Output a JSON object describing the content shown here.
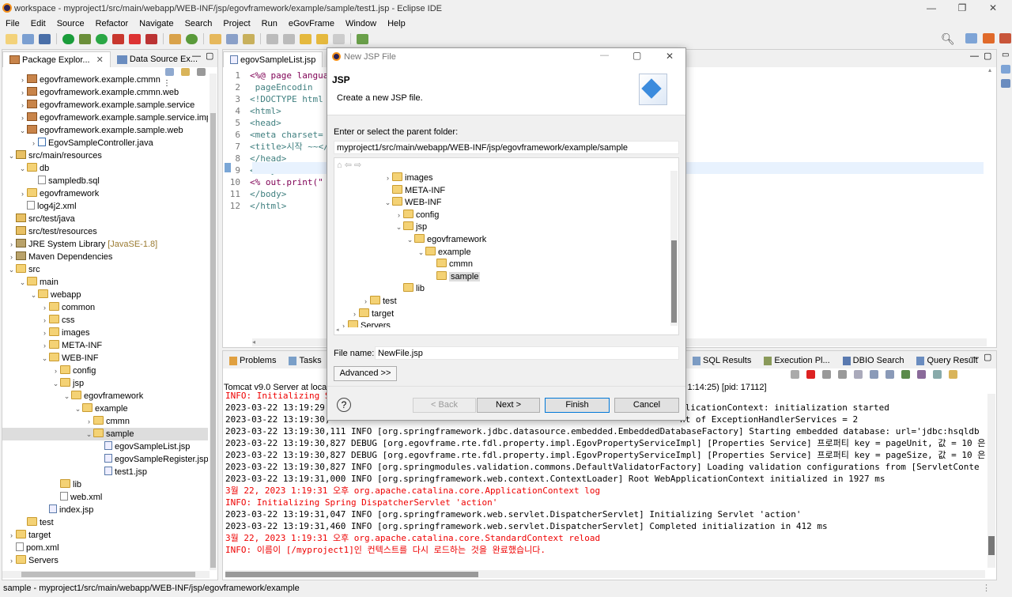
{
  "window": {
    "title": "workspace - myproject1/src/main/webapp/WEB-INF/jsp/egovframework/example/sample/test1.jsp - Eclipse IDE",
    "minimize": "—",
    "maximize": "❐",
    "close": "✕"
  },
  "menu": [
    "File",
    "Edit",
    "Source",
    "Refactor",
    "Navigate",
    "Search",
    "Project",
    "Run",
    "eGovFrame",
    "Window",
    "Help"
  ],
  "explorer": {
    "tab1": "Package Explor...",
    "tab2": "Data Source Ex...",
    "rows": [
      {
        "label": "egovframework.example.cmmn",
        "icon": "pkg",
        "indent": 1,
        "arrow": ">"
      },
      {
        "label": "egovframework.example.cmmn.web",
        "icon": "pkg",
        "indent": 1,
        "arrow": ">"
      },
      {
        "label": "egovframework.example.sample.service",
        "icon": "pkg",
        "indent": 1,
        "arrow": ">"
      },
      {
        "label": "egovframework.example.sample.service.impl",
        "icon": "pkg",
        "indent": 1,
        "arrow": ">"
      },
      {
        "label": "egovframework.example.sample.web",
        "icon": "pkg",
        "indent": 1,
        "arrow": "v"
      },
      {
        "label": "EgovSampleController.java",
        "icon": "java",
        "indent": 2,
        "arrow": ">"
      },
      {
        "label": "src/main/resources",
        "icon": "src",
        "indent": 0,
        "arrow": "v"
      },
      {
        "label": "db",
        "icon": "fold",
        "indent": 1,
        "arrow": "v"
      },
      {
        "label": "sampledb.sql",
        "icon": "file",
        "indent": 2,
        "arrow": ""
      },
      {
        "label": "egovframework",
        "icon": "fold",
        "indent": 1,
        "arrow": ">"
      },
      {
        "label": "log4j2.xml",
        "icon": "file",
        "indent": 1,
        "arrow": ""
      },
      {
        "label": "src/test/java",
        "icon": "src",
        "indent": 0,
        "arrow": ""
      },
      {
        "label": "src/test/resources",
        "icon": "src",
        "indent": 0,
        "arrow": ""
      },
      {
        "label": "JRE System Library",
        "suffix": "[JavaSE-1.8]",
        "icon": "lib",
        "indent": 0,
        "arrow": ">"
      },
      {
        "label": "Maven Dependencies",
        "icon": "lib",
        "indent": 0,
        "arrow": ">"
      },
      {
        "label": "src",
        "icon": "fold",
        "indent": 0,
        "arrow": "v"
      },
      {
        "label": "main",
        "icon": "fold",
        "indent": 1,
        "arrow": "v"
      },
      {
        "label": "webapp",
        "icon": "fold",
        "indent": 2,
        "arrow": "v"
      },
      {
        "label": "common",
        "icon": "fold",
        "indent": 3,
        "arrow": ">"
      },
      {
        "label": "css",
        "icon": "fold",
        "indent": 3,
        "arrow": ">"
      },
      {
        "label": "images",
        "icon": "fold",
        "indent": 3,
        "arrow": ">"
      },
      {
        "label": "META-INF",
        "icon": "fold",
        "indent": 3,
        "arrow": ">"
      },
      {
        "label": "WEB-INF",
        "icon": "fold",
        "indent": 3,
        "arrow": "v"
      },
      {
        "label": "config",
        "icon": "fold",
        "indent": 4,
        "arrow": ">"
      },
      {
        "label": "jsp",
        "icon": "fold",
        "indent": 4,
        "arrow": "v"
      },
      {
        "label": "egovframework",
        "icon": "fold",
        "indent": 5,
        "arrow": "v"
      },
      {
        "label": "example",
        "icon": "fold",
        "indent": 6,
        "arrow": "v"
      },
      {
        "label": "cmmn",
        "icon": "fold",
        "indent": 7,
        "arrow": ">"
      },
      {
        "label": "sample",
        "icon": "fold",
        "indent": 7,
        "arrow": "v",
        "selected": true
      },
      {
        "label": "egovSampleList.jsp",
        "icon": "jsp",
        "indent": 8,
        "arrow": ""
      },
      {
        "label": "egovSampleRegister.jsp",
        "icon": "jsp",
        "indent": 8,
        "arrow": ""
      },
      {
        "label": "test1.jsp",
        "icon": "jsp",
        "indent": 8,
        "arrow": ""
      },
      {
        "label": "lib",
        "icon": "fold",
        "indent": 4,
        "arrow": ""
      },
      {
        "label": "web.xml",
        "icon": "file",
        "indent": 4,
        "arrow": ""
      },
      {
        "label": "index.jsp",
        "icon": "jsp",
        "indent": 3,
        "arrow": ""
      },
      {
        "label": "test",
        "icon": "fold",
        "indent": 1,
        "arrow": ""
      },
      {
        "label": "target",
        "icon": "fold",
        "indent": 0,
        "arrow": ">"
      },
      {
        "label": "pom.xml",
        "icon": "file",
        "indent": 0,
        "arrow": ""
      },
      {
        "label": "Servers",
        "icon": "fold",
        "indent": 0,
        "arrow": ">"
      }
    ]
  },
  "editor": {
    "tab": "egovSampleList.jsp",
    "lines": [
      {
        "n": "1",
        "html": "<%@ page langua"
      },
      {
        "n": "2",
        "html": "    pageEncodin"
      },
      {
        "n": "3",
        "html": "<!DOCTYPE html"
      },
      {
        "n": "4",
        "html": "<html>"
      },
      {
        "n": "5",
        "html": "<head>"
      },
      {
        "n": "6",
        "html": "<meta charset="
      },
      {
        "n": "7",
        "html": "<title>시작 ~~</"
      },
      {
        "n": "8",
        "html": "</head>"
      },
      {
        "n": "9",
        "html": "<body>"
      },
      {
        "n": "10",
        "html": "<% out.print(\""
      },
      {
        "n": "11",
        "html": "</body>"
      },
      {
        "n": "12",
        "html": "</html>"
      }
    ]
  },
  "bottom": {
    "tabs": [
      "Problems",
      "Tasks"
    ],
    "tabs_right": [
      "SQL Results",
      "Execution Pl...",
      "DBIO Search",
      "Query Result"
    ],
    "server_label": "Tomcat v9.0 Server at locall",
    "server_right": "≡ 1:14:25) [pid: 17112]",
    "console": [
      {
        "text": "INFO: Initializing S",
        "red": true
      },
      {
        "text": "2023-03-22 13:19:29,",
        "red": false,
        "right": "plicationContext: initialization started"
      },
      {
        "text": "2023-03-22 13:19:30,",
        "red": false,
        "right": "nt of ExceptionHandlerServices = 2"
      },
      {
        "text": "2023-03-22 13:19:30,111  INFO [org.springframework.jdbc.datasource.embedded.EmbeddedDatabaseFactory] Starting embedded database: url='jdbc:hsqldb",
        "red": false
      },
      {
        "text": "2023-03-22 13:19:30,827 DEBUG [org.egovframe.rte.fdl.property.impl.EgovPropertyServiceImpl] [Properties Service] 프로퍼티 key = pageUnit, 값 = 10 은",
        "red": false
      },
      {
        "text": "2023-03-22 13:19:30,827 DEBUG [org.egovframe.rte.fdl.property.impl.EgovPropertyServiceImpl] [Properties Service] 프로퍼티 key = pageSize, 값 = 10 은",
        "red": false
      },
      {
        "text": "2023-03-22 13:19:30,827  INFO [org.springmodules.validation.commons.DefaultValidatorFactory] Loading validation configurations from [ServletConte",
        "red": false
      },
      {
        "text": "2023-03-22 13:19:31,000  INFO [org.springframework.web.context.ContextLoader] Root WebApplicationContext initialized in 1927 ms",
        "red": false
      },
      {
        "text": "3월 22, 2023 1:19:31 오후 org.apache.catalina.core.ApplicationContext log",
        "red": true
      },
      {
        "text": "INFO: Initializing Spring DispatcherServlet 'action'",
        "red": true
      },
      {
        "text": "2023-03-22 13:19:31,047  INFO [org.springframework.web.servlet.DispatcherServlet] Initializing Servlet 'action'",
        "red": false
      },
      {
        "text": "2023-03-22 13:19:31,460  INFO [org.springframework.web.servlet.DispatcherServlet] Completed initialization in 412 ms",
        "red": false
      },
      {
        "text": "3월 22, 2023 1:19:31 오후 org.apache.catalina.core.StandardContext reload",
        "red": true
      },
      {
        "text": "INFO: 이름이 [/myproject1]인 컨텍스트를 다시 로드하는 것을 완료했습니다.",
        "red": true
      }
    ]
  },
  "status": {
    "text": "sample - myproject1/src/main/webapp/WEB-INF/jsp/egovframework/example"
  },
  "dialog": {
    "title": "New JSP File",
    "heading": "JSP",
    "subtitle": "Create a new JSP file.",
    "folder_label": "Enter or select the parent folder:",
    "folder_value": "myproject1/src/main/webapp/WEB-INF/jsp/egovframework/example/sample",
    "tree": [
      {
        "label": "images",
        "indent": 4,
        "arrow": ">"
      },
      {
        "label": "META-INF",
        "indent": 4,
        "arrow": ""
      },
      {
        "label": "WEB-INF",
        "indent": 4,
        "arrow": "v"
      },
      {
        "label": "config",
        "indent": 5,
        "arrow": ">"
      },
      {
        "label": "jsp",
        "indent": 5,
        "arrow": "v"
      },
      {
        "label": "egovframework",
        "indent": 6,
        "arrow": "v"
      },
      {
        "label": "example",
        "indent": 7,
        "arrow": "v"
      },
      {
        "label": "cmmn",
        "indent": 8,
        "arrow": ""
      },
      {
        "label": "sample",
        "indent": 8,
        "arrow": "",
        "selected": true
      },
      {
        "label": "lib",
        "indent": 5,
        "arrow": ""
      },
      {
        "label": "test",
        "indent": 2,
        "arrow": ">"
      },
      {
        "label": "target",
        "indent": 1,
        "arrow": ">"
      },
      {
        "label": "Servers",
        "indent": 0,
        "arrow": ">"
      }
    ],
    "filename_label": "File name:",
    "filename_value": "NewFile.jsp",
    "advanced": "Advanced >>",
    "back": "< Back",
    "next": "Next >",
    "finish": "Finish",
    "cancel": "Cancel",
    "help": "?"
  }
}
